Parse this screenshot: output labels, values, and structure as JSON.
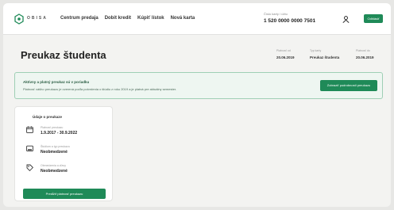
{
  "header": {
    "brand": "OBISA",
    "nav": [
      "Centrum predaja",
      "Dobit kredit",
      "Kúpiť lístok",
      "Nová karta"
    ],
    "account_label": "Číslo karty / účtu",
    "account_number": "1 520 0000 0000 7501",
    "action_label": "Odhlásiť"
  },
  "page": {
    "title": "Preukaz študenta",
    "meta": [
      {
        "label": "Platnosť od",
        "value": "20.06.2019"
      },
      {
        "label": "Typ karty",
        "value": "Preukaz študenta"
      },
      {
        "label": "Platnosť do",
        "value": "20.06.2019"
      }
    ]
  },
  "banner": {
    "title": "Aktívny a platný preukaz sú v poriadku",
    "text": "Platnosť vášho preukazu je overená podľa potvrdenia o štúdiu z roku 2019 a je platná pre aktuálny semester.",
    "button": "Zobraziť podrobnosti preukazu"
  },
  "card": {
    "title": "Údaje o preukaze",
    "rows": [
      {
        "label": "Platnosť preukazu",
        "value": "1.9.2017 - 30.9.2022"
      },
      {
        "label": "Štúdium a typ preukazu",
        "value": "Neobmedzené"
      },
      {
        "label": "Obmedzenia a zľavy",
        "value": "Neobmedzené"
      }
    ],
    "button": "Predĺžiť platnosť preukazu"
  },
  "colors": {
    "accent": "#1f8a58",
    "banner_bg": "#eef6f1",
    "banner_border": "#9fcfb5"
  }
}
